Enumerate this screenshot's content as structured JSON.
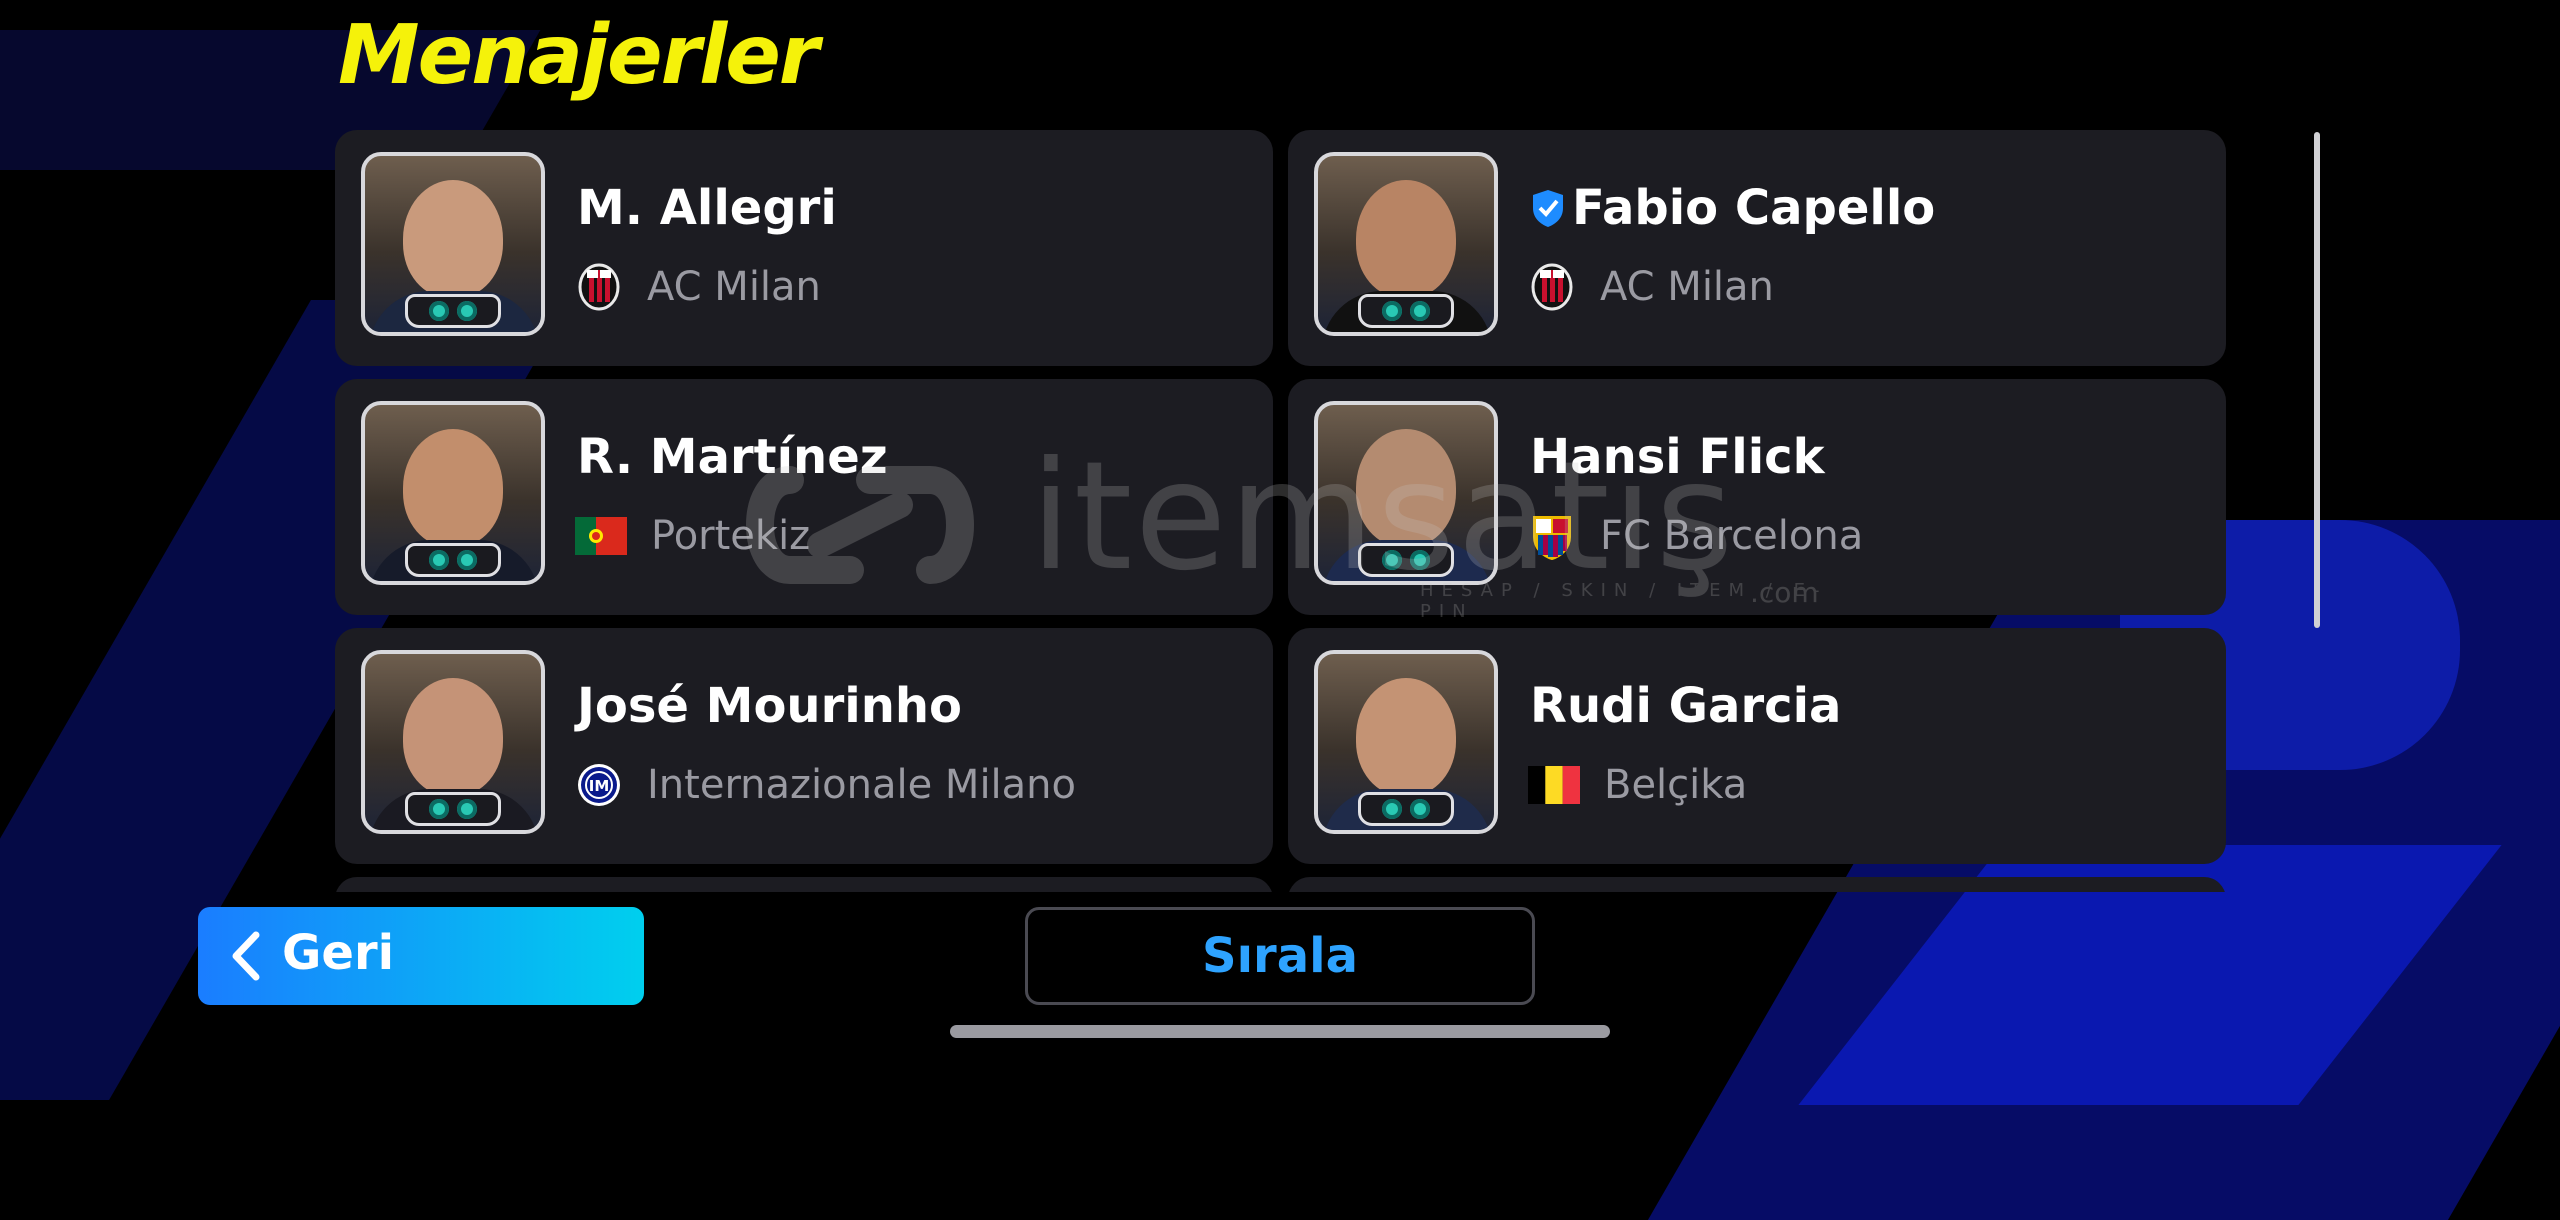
{
  "page": {
    "title": "Menajerler"
  },
  "managers": [
    {
      "name": "M. Allegri",
      "team": "AC Milan",
      "team_icon": "ac-milan-crest-icon",
      "verified": false
    },
    {
      "name": "Fabio Capello",
      "team": "AC Milan",
      "team_icon": "ac-milan-crest-icon",
      "verified": true
    },
    {
      "name": "R. Martínez",
      "team": "Portekiz",
      "team_icon": "portugal-flag-icon",
      "verified": false
    },
    {
      "name": "Hansi Flick",
      "team": "FC Barcelona",
      "team_icon": "fc-barcelona-crest-icon",
      "verified": false
    },
    {
      "name": "José Mourinho",
      "team": "Internazionale Milano",
      "team_icon": "inter-milan-crest-icon",
      "verified": false
    },
    {
      "name": "Rudi Garcia",
      "team": "Belçika",
      "team_icon": "belgium-flag-icon",
      "verified": false
    }
  ],
  "footer": {
    "back_label": "Geri",
    "sort_label": "Sırala"
  },
  "watermark": {
    "brand": "itemsatış",
    "tagline": "HESAP / SKIN / ITEM / E-PIN",
    "suffix": ".com"
  },
  "colors": {
    "title": "#f5f20a",
    "card_bg": "#1c1c22",
    "back_gradient_start": "#1a7dff",
    "back_gradient_end": "#00cfee",
    "sort_text": "#2ea3ff",
    "verified_badge": "#1e8cff"
  }
}
